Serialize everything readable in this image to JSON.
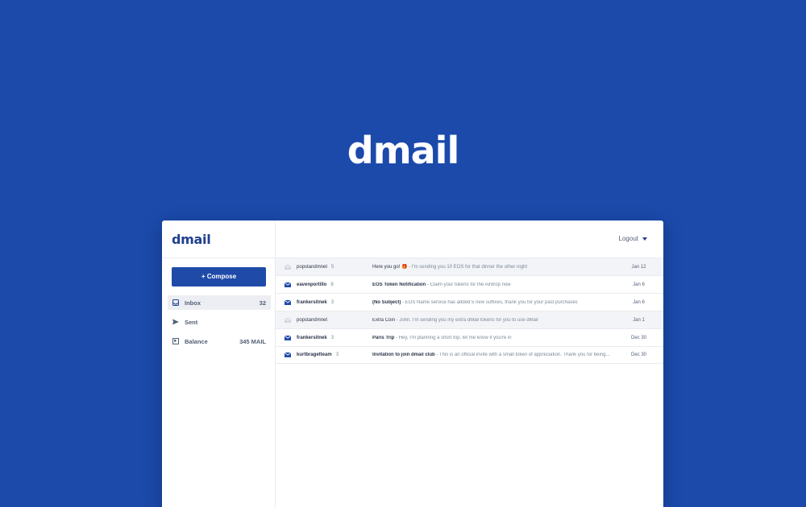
{
  "hero": {
    "logo": "dmail"
  },
  "sidebar": {
    "logo": "dmail",
    "compose_label": "+ Compose",
    "items": [
      {
        "label": "Inbox",
        "count": "32",
        "icon": "inbox-icon",
        "active": true
      },
      {
        "label": "Sent",
        "count": "",
        "icon": "send-icon",
        "active": false
      },
      {
        "label": "Balance",
        "count": "345 MAIL",
        "icon": "wallet-icon",
        "active": false
      }
    ]
  },
  "header": {
    "logout_label": "Logout"
  },
  "emails": [
    {
      "sender": "popstandmnet",
      "count": "5",
      "subject": "Here you go! 🎁",
      "snippet": " - I'm sending you 10 EOS for that dinner the other night",
      "date": "Jan 12",
      "read": true
    },
    {
      "sender": "eavenportillo",
      "count": "8",
      "subject": "EOS Token Notification",
      "snippet": " - Claim your tokens for the Airdrop now",
      "date": "Jan 6",
      "read": false
    },
    {
      "sender": "frankersitnek",
      "count": "3",
      "subject": "(No Subject)",
      "snippet": " - EOS Name service has added 5 new suffixes, thank you for your past purchases",
      "date": "Jan 6",
      "read": false
    },
    {
      "sender": "popstandmnet",
      "count": "",
      "subject": "Extra Coin",
      "snippet": " - John, I'm sending you my extra dMail tokens for you to use dMail",
      "date": "Jan 1",
      "read": true
    },
    {
      "sender": "frankersitnek",
      "count": "3",
      "subject": "Paris Trip",
      "snippet": " - Hey, I'm planning a short trip, let me know if you're in",
      "date": "Dec 30",
      "read": false
    },
    {
      "sender": "kurtbragetteam",
      "count": "3",
      "subject": "Invitation to join dmail club",
      "snippet": " - This is an official invite with a small token of appreciation. Thank you for being...",
      "date": "Dec 30",
      "read": false
    }
  ],
  "colors": {
    "background": "#1b4aab",
    "accent": "#1f4aa8",
    "text": "#525f75"
  }
}
